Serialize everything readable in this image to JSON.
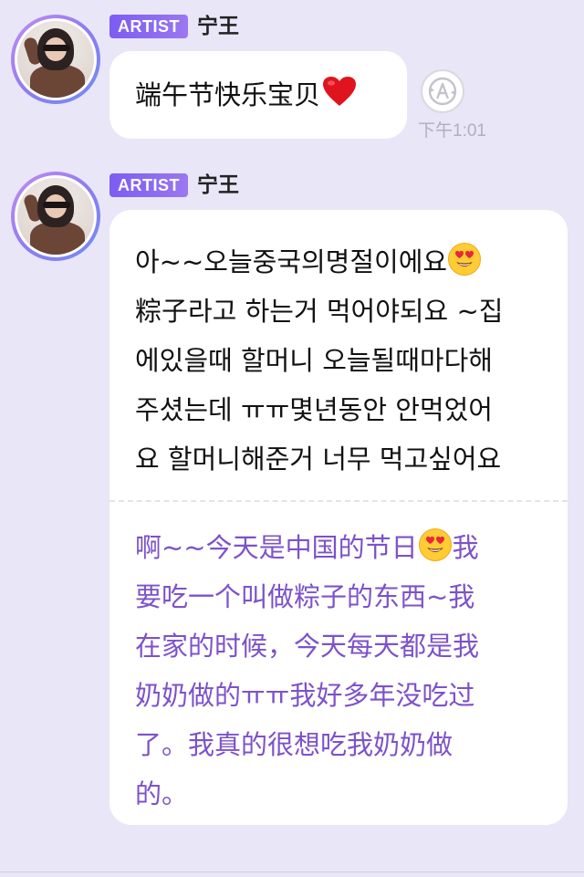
{
  "messages": [
    {
      "badge": "ARTIST",
      "sender": "宁王",
      "text": "端午节快乐宝贝",
      "emoji": "heart-emoji",
      "time": "下午1:01",
      "translate_icon": "translate-icon"
    },
    {
      "badge": "ARTIST",
      "sender": "宁王",
      "original_lines": [
        "아~~오늘중국의명절이에요",
        "粽子라고 하는거 먹어야되요 ~집",
        "에있을때 할머니 오늘될때마다해",
        "주셨는데 ㅠㅠ몇년동안 안먹었어",
        "요 할머니해준거 너무 먹고싶어요"
      ],
      "translation_lines": [
        "啊~~今天是中国的节日",
        "我",
        "要吃一个叫做粽子的东西~我",
        "在家的时候，今天每天都是我",
        "奶奶做的ㅠㅠ我好多年没吃过",
        "了。我真的很想吃我奶奶做",
        "的。"
      ],
      "emoji": "heart-eyes-emoji"
    }
  ],
  "colors": {
    "background": "#e9e6f7",
    "badge": "#7c5cf2",
    "translation_text": "#7d52c9",
    "time_text": "#b1afba"
  }
}
